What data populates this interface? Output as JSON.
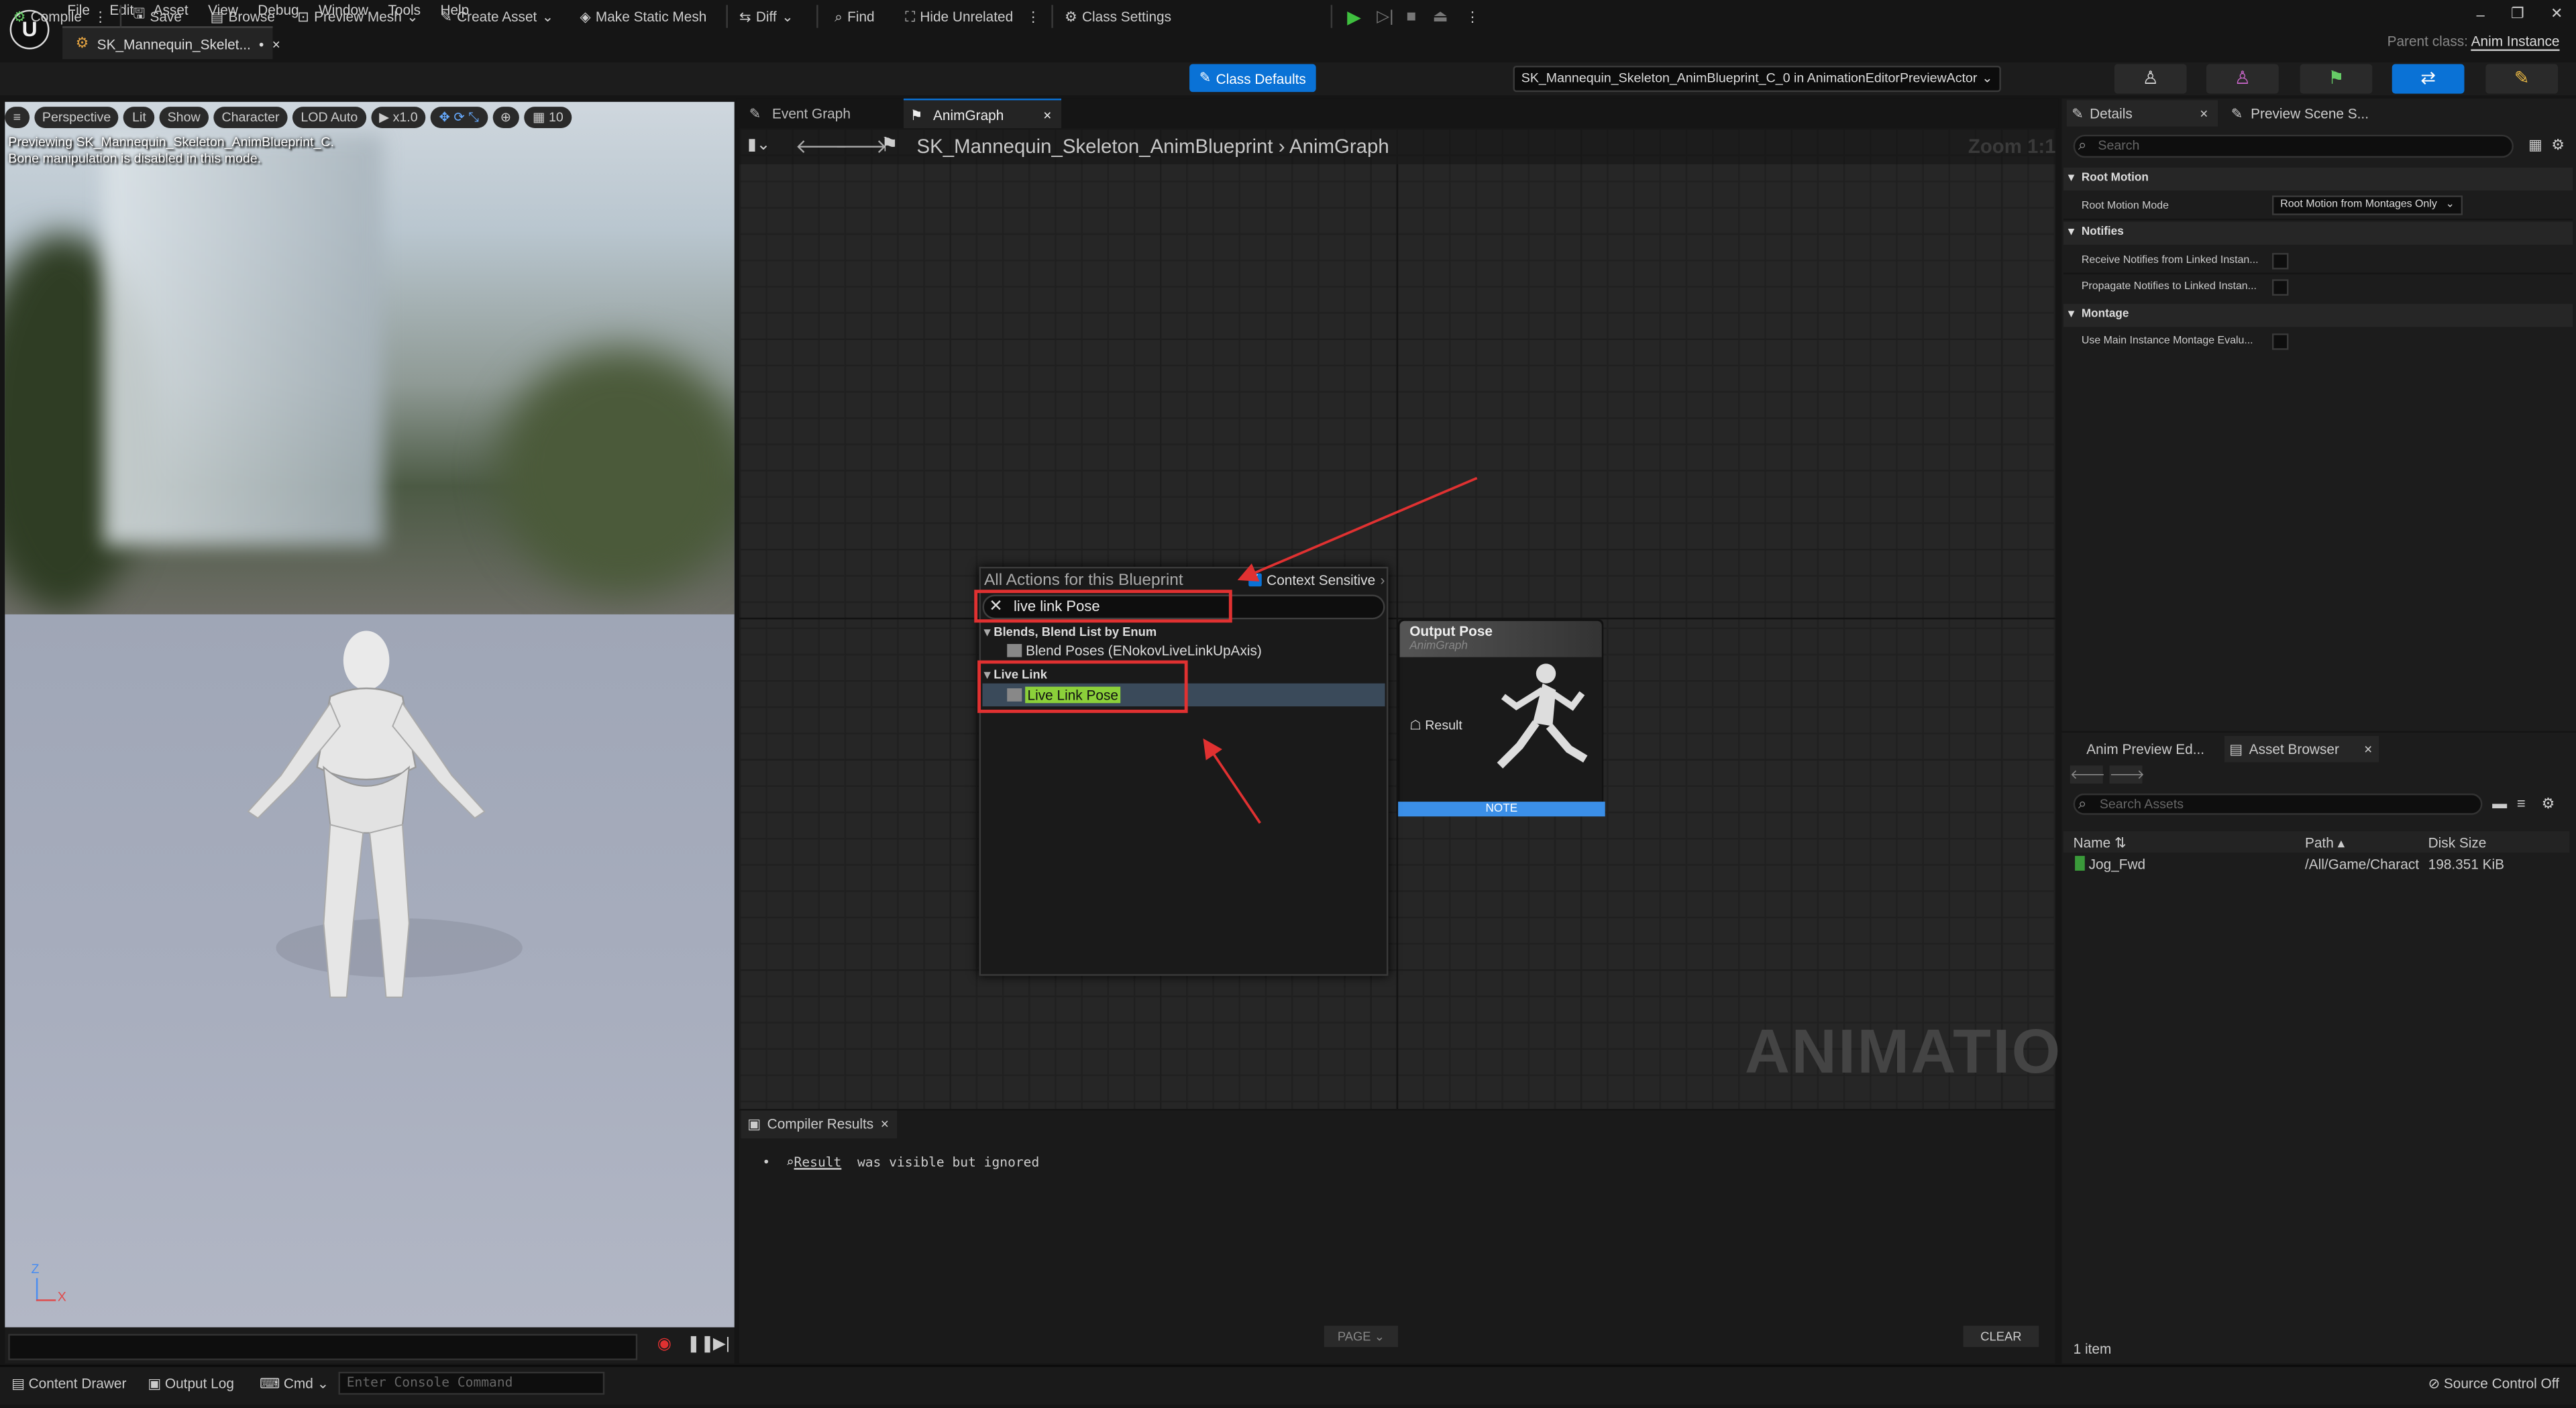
{
  "menubar": {
    "logo": "U",
    "items": [
      "File",
      "Edit",
      "Asset",
      "View",
      "Debug",
      "Window",
      "Tools",
      "Help"
    ],
    "doc_tab": "SK_Mannequin_Skelet...",
    "doc_tab_modified": "•",
    "parent_class_label": "Parent class:",
    "parent_class_value": "Anim Instance"
  },
  "toolbar": {
    "compile": "Compile",
    "save": "Save",
    "browse": "Browse",
    "preview_mesh": "Preview Mesh",
    "create_asset": "Create Asset",
    "make_static_mesh": "Make Static Mesh",
    "diff": "Diff",
    "find": "Find",
    "hide_unrelated": "Hide Unrelated",
    "class_settings": "Class Settings",
    "class_defaults": "Class Defaults",
    "debug_actor": "SK_Mannequin_Skeleton_AnimBlueprint_C_0 in AnimationEditorPreviewActor"
  },
  "viewport": {
    "perspective": "Perspective",
    "lit": "Lit",
    "show": "Show",
    "character": "Character",
    "lod": "LOD Auto",
    "speed": "x1.0",
    "grid": "10",
    "message_line1": "Previewing SK_Mannequin_Skeleton_AnimBlueprint_C.",
    "message_line2": "Bone manipulation is disabled in this mode.",
    "axis_z": "Z",
    "axis_x": "X"
  },
  "graph": {
    "tabs": [
      "Event Graph",
      "AnimGraph"
    ],
    "breadcrumb_root": "SK_Mannequin_Skeleton_AnimBlueprint",
    "breadcrumb_leaf": "AnimGraph",
    "zoom": "Zoom 1:1",
    "watermark": "ANIMATION"
  },
  "action_menu": {
    "title": "All Actions for this Blueprint",
    "context_sensitive": "Context Sensitive",
    "search_value": "live link Pose",
    "categories": [
      {
        "name": "Blends, Blend List by Enum",
        "items": [
          "Blend Poses (ENokovLiveLinkUpAxis)"
        ]
      },
      {
        "name": "Live Link",
        "items": [
          "Live Link Pose"
        ]
      }
    ]
  },
  "output_node": {
    "title": "Output Pose",
    "subtitle": "AnimGraph",
    "pin": "Result",
    "note": "NOTE"
  },
  "compiler": {
    "tab": "Compiler Results",
    "message_link": "Result",
    "message_rest": "was visible but ignored",
    "page": "PAGE",
    "clear": "CLEAR"
  },
  "details": {
    "tab1": "Details",
    "tab2": "Preview Scene S...",
    "search_placeholder": "Search",
    "sections": [
      {
        "name": "Root Motion",
        "props": [
          {
            "label": "Root Motion Mode",
            "value": "Root Motion from Montages Only"
          }
        ]
      },
      {
        "name": "Notifies",
        "props": [
          {
            "label": "Receive Notifies from Linked Instan..."
          },
          {
            "label": "Propagate Notifies to Linked Instan..."
          }
        ]
      },
      {
        "name": "Montage",
        "props": [
          {
            "label": "Use Main Instance Montage Evalu..."
          }
        ]
      }
    ]
  },
  "asset_browser": {
    "tab1": "Anim Preview Ed...",
    "tab2": "Asset Browser",
    "search_placeholder": "Search Assets",
    "columns": [
      "Name",
      "Path",
      "Disk Size"
    ],
    "rows": [
      {
        "name": "Jog_Fwd",
        "path": "/All/Game/Charact",
        "size": "198.351 KiB"
      }
    ],
    "count": "1 item"
  },
  "statusbar": {
    "content_drawer": "Content Drawer",
    "output_log": "Output Log",
    "cmd": "Cmd",
    "console_placeholder": "Enter Console Command",
    "source_control": "Source Control Off"
  },
  "colors": {
    "accent": "#0a72d6",
    "annotation": "#e03131",
    "highlight": "#8bd03a",
    "note": "#3b8fe8"
  }
}
